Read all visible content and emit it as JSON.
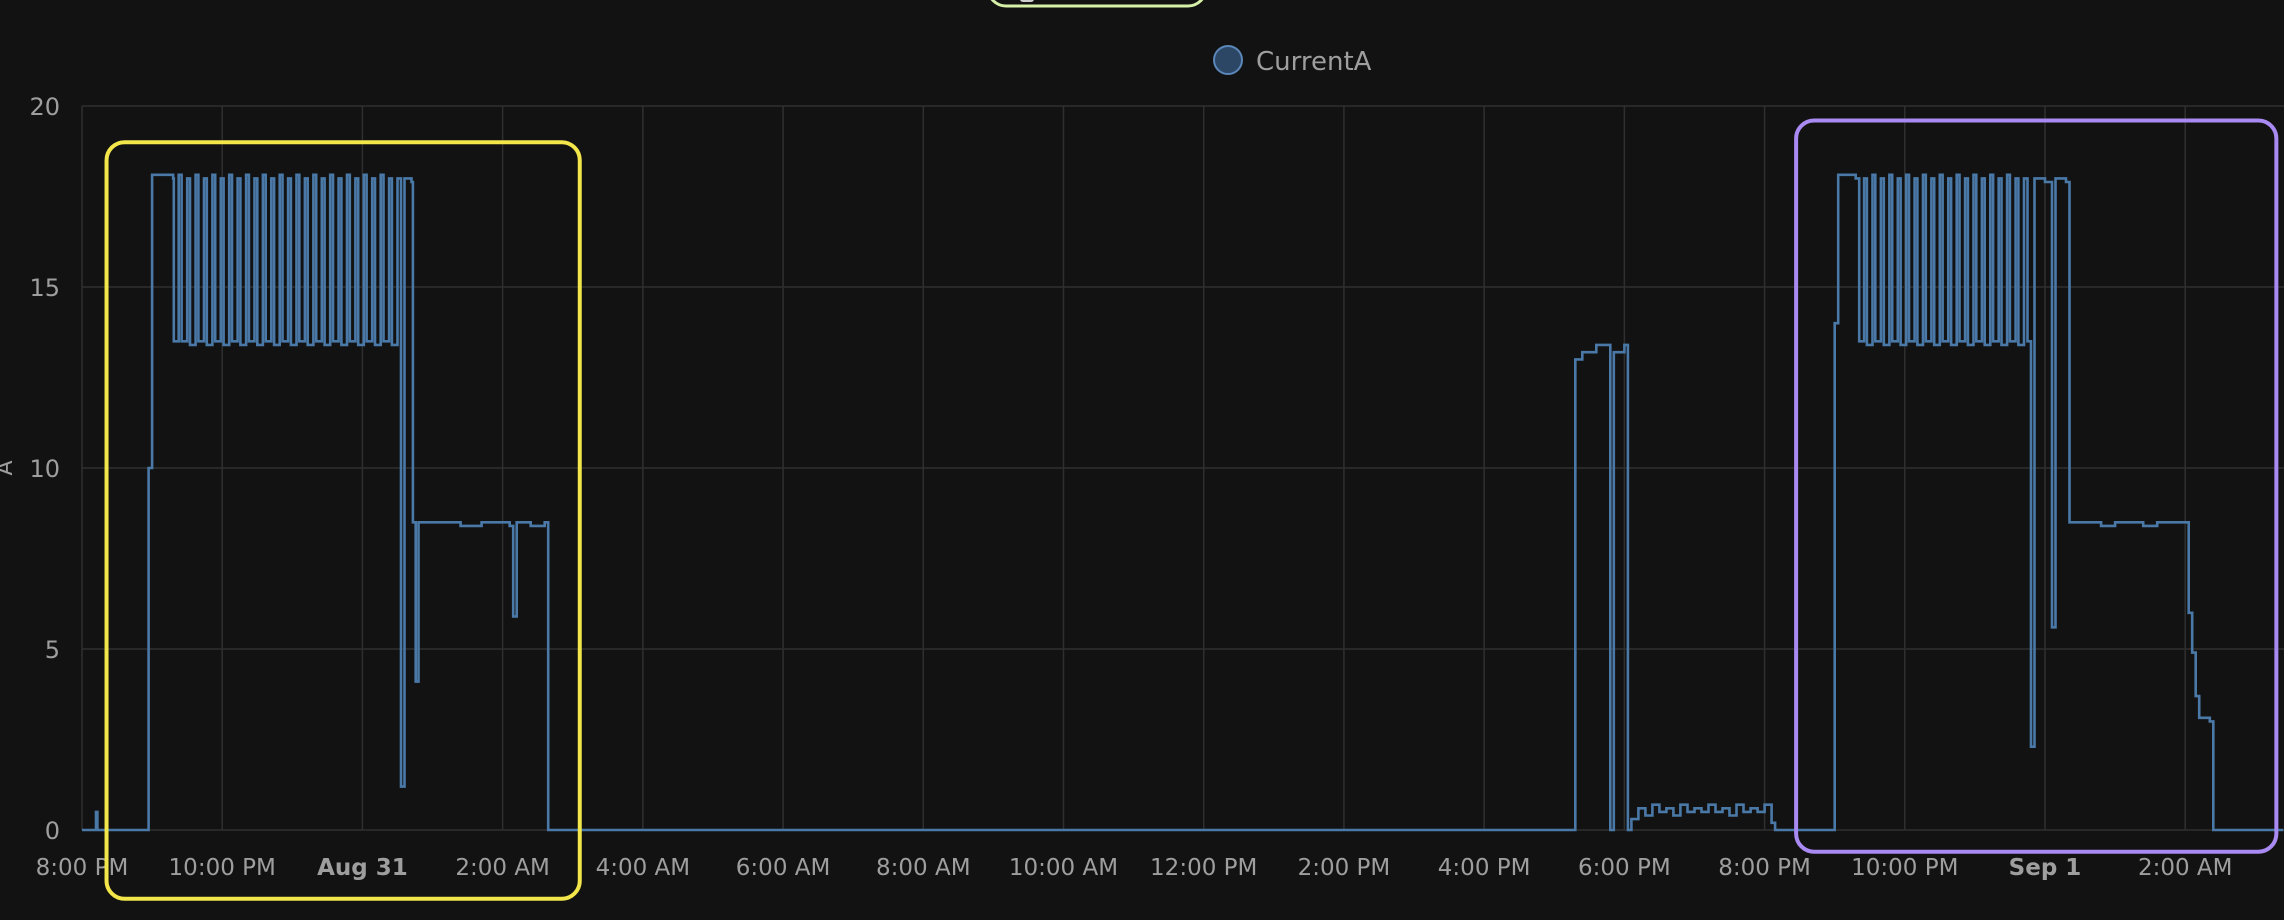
{
  "colors": {
    "background": "#121212",
    "grid": "#2f2f2f",
    "axis_text": "#9e9e9e",
    "series": "#4a79a8",
    "legend_swatch_fill": "#2c4766",
    "legend_swatch_border": "#5a86b8",
    "yellow_box": "#f2e64a",
    "purple_box": "#a98af2",
    "top_pill": "#d7f0a8"
  },
  "legend": {
    "label": "CurrentA"
  },
  "chart_data": {
    "type": "line",
    "title": "",
    "xlabel": "",
    "ylabel": "A",
    "ylim": [
      0,
      20
    ],
    "yticks": [
      0,
      5,
      10,
      15,
      20
    ],
    "x_unit": "hours since 8:00 PM (Aug 30)",
    "xlim": [
      0,
      31.4
    ],
    "xticks": [
      {
        "label": "8:00 PM",
        "bold": false
      },
      {
        "label": "10:00 PM",
        "bold": false
      },
      {
        "label": "Aug 31",
        "bold": true
      },
      {
        "label": "2:00 AM",
        "bold": false
      },
      {
        "label": "4:00 AM",
        "bold": false
      },
      {
        "label": "6:00 AM",
        "bold": false
      },
      {
        "label": "8:00 AM",
        "bold": false
      },
      {
        "label": "10:00 AM",
        "bold": false
      },
      {
        "label": "12:00 PM",
        "bold": false
      },
      {
        "label": "2:00 PM",
        "bold": false
      },
      {
        "label": "4:00 PM",
        "bold": false
      },
      {
        "label": "6:00 PM",
        "bold": false
      },
      {
        "label": "8:00 PM",
        "bold": false
      },
      {
        "label": "10:00 PM",
        "bold": false
      },
      {
        "label": "Sep 1",
        "bold": true
      },
      {
        "label": "2:00 AM",
        "bold": false
      }
    ],
    "series": [
      {
        "name": "CurrentA",
        "step": true,
        "points": [
          [
            0,
            0
          ],
          [
            0.2,
            0
          ],
          [
            0.2,
            0.5
          ],
          [
            0.22,
            0.5
          ],
          [
            0.22,
            0
          ],
          [
            0.95,
            0
          ],
          [
            0.95,
            10
          ],
          [
            1.0,
            18.1
          ],
          [
            1.3,
            18.0
          ],
          [
            1.3,
            18.0
          ],
          [
            1.31,
            13.5
          ],
          [
            1.38,
            18.1
          ],
          [
            1.42,
            13.5
          ],
          [
            1.5,
            18.0
          ],
          [
            1.54,
            13.4
          ],
          [
            1.62,
            18.1
          ],
          [
            1.66,
            13.5
          ],
          [
            1.74,
            18.0
          ],
          [
            1.78,
            13.4
          ],
          [
            1.86,
            18.1
          ],
          [
            1.9,
            13.5
          ],
          [
            1.98,
            18.0
          ],
          [
            2.02,
            13.4
          ],
          [
            2.1,
            18.1
          ],
          [
            2.14,
            13.5
          ],
          [
            2.22,
            18.0
          ],
          [
            2.26,
            13.4
          ],
          [
            2.34,
            18.1
          ],
          [
            2.38,
            13.5
          ],
          [
            2.46,
            18.0
          ],
          [
            2.5,
            13.4
          ],
          [
            2.58,
            18.1
          ],
          [
            2.62,
            13.5
          ],
          [
            2.7,
            18.0
          ],
          [
            2.74,
            13.4
          ],
          [
            2.82,
            18.1
          ],
          [
            2.86,
            13.5
          ],
          [
            2.94,
            18.0
          ],
          [
            2.98,
            13.4
          ],
          [
            3.06,
            18.1
          ],
          [
            3.1,
            13.5
          ],
          [
            3.18,
            18.0
          ],
          [
            3.22,
            13.4
          ],
          [
            3.3,
            18.1
          ],
          [
            3.34,
            13.5
          ],
          [
            3.42,
            18.0
          ],
          [
            3.46,
            13.4
          ],
          [
            3.54,
            18.1
          ],
          [
            3.58,
            13.5
          ],
          [
            3.66,
            18.0
          ],
          [
            3.7,
            13.4
          ],
          [
            3.78,
            18.1
          ],
          [
            3.82,
            13.5
          ],
          [
            3.9,
            18.0
          ],
          [
            3.94,
            13.4
          ],
          [
            4.02,
            18.1
          ],
          [
            4.06,
            13.5
          ],
          [
            4.14,
            18.0
          ],
          [
            4.18,
            13.4
          ],
          [
            4.26,
            18.1
          ],
          [
            4.3,
            13.5
          ],
          [
            4.38,
            18.0
          ],
          [
            4.42,
            13.4
          ],
          [
            4.5,
            18.0
          ],
          [
            4.55,
            13.4
          ],
          [
            4.55,
            1.2
          ],
          [
            4.6,
            18.0
          ],
          [
            4.7,
            17.9
          ],
          [
            4.72,
            8.5
          ],
          [
            4.76,
            4.1
          ],
          [
            4.8,
            8.5
          ],
          [
            5.3,
            8.5
          ],
          [
            5.4,
            8.4
          ],
          [
            5.7,
            8.5
          ],
          [
            6.1,
            8.4
          ],
          [
            6.15,
            5.9
          ],
          [
            6.2,
            8.5
          ],
          [
            6.4,
            8.4
          ],
          [
            6.6,
            8.5
          ],
          [
            6.65,
            0
          ],
          [
            21.3,
            0
          ],
          [
            21.3,
            13.0
          ],
          [
            21.4,
            13.2
          ],
          [
            21.6,
            13.4
          ],
          [
            21.8,
            13.4
          ],
          [
            21.8,
            0
          ],
          [
            21.85,
            13.2
          ],
          [
            22.0,
            13.4
          ],
          [
            22.05,
            0
          ],
          [
            22.1,
            0.3
          ],
          [
            22.2,
            0.6
          ],
          [
            22.3,
            0.4
          ],
          [
            22.4,
            0.7
          ],
          [
            22.5,
            0.5
          ],
          [
            22.6,
            0.6
          ],
          [
            22.7,
            0.4
          ],
          [
            22.8,
            0.7
          ],
          [
            22.9,
            0.5
          ],
          [
            23.0,
            0.6
          ],
          [
            23.1,
            0.5
          ],
          [
            23.2,
            0.7
          ],
          [
            23.3,
            0.5
          ],
          [
            23.4,
            0.6
          ],
          [
            23.5,
            0.4
          ],
          [
            23.6,
            0.7
          ],
          [
            23.7,
            0.5
          ],
          [
            23.8,
            0.6
          ],
          [
            23.9,
            0.5
          ],
          [
            24.0,
            0.7
          ],
          [
            24.1,
            0.2
          ],
          [
            24.15,
            0
          ],
          [
            24.95,
            0
          ],
          [
            25.0,
            14.0
          ],
          [
            25.05,
            18.1
          ],
          [
            25.3,
            18.0
          ],
          [
            25.35,
            13.5
          ],
          [
            25.42,
            18.0
          ],
          [
            25.46,
            13.4
          ],
          [
            25.54,
            18.1
          ],
          [
            25.58,
            13.5
          ],
          [
            25.66,
            18.0
          ],
          [
            25.7,
            13.4
          ],
          [
            25.78,
            18.1
          ],
          [
            25.82,
            13.5
          ],
          [
            25.9,
            18.0
          ],
          [
            25.94,
            13.4
          ],
          [
            26.02,
            18.1
          ],
          [
            26.06,
            13.5
          ],
          [
            26.14,
            18.0
          ],
          [
            26.18,
            13.4
          ],
          [
            26.26,
            18.1
          ],
          [
            26.3,
            13.5
          ],
          [
            26.38,
            18.0
          ],
          [
            26.42,
            13.4
          ],
          [
            26.5,
            18.1
          ],
          [
            26.54,
            13.5
          ],
          [
            26.62,
            18.0
          ],
          [
            26.66,
            13.4
          ],
          [
            26.74,
            18.1
          ],
          [
            26.78,
            13.5
          ],
          [
            26.86,
            18.0
          ],
          [
            26.9,
            13.4
          ],
          [
            26.98,
            18.1
          ],
          [
            27.02,
            13.5
          ],
          [
            27.1,
            18.0
          ],
          [
            27.14,
            13.4
          ],
          [
            27.22,
            18.1
          ],
          [
            27.26,
            13.5
          ],
          [
            27.34,
            18.0
          ],
          [
            27.38,
            13.4
          ],
          [
            27.46,
            18.1
          ],
          [
            27.5,
            13.5
          ],
          [
            27.58,
            18.0
          ],
          [
            27.62,
            13.4
          ],
          [
            27.7,
            18.0
          ],
          [
            27.75,
            13.5
          ],
          [
            27.8,
            2.3
          ],
          [
            27.85,
            18.0
          ],
          [
            28.0,
            17.9
          ],
          [
            28.1,
            5.6
          ],
          [
            28.15,
            18.0
          ],
          [
            28.3,
            17.9
          ],
          [
            28.35,
            8.5
          ],
          [
            28.6,
            8.5
          ],
          [
            28.8,
            8.4
          ],
          [
            29.0,
            8.5
          ],
          [
            29.4,
            8.4
          ],
          [
            29.6,
            8.5
          ],
          [
            30.0,
            8.5
          ],
          [
            30.05,
            6.0
          ],
          [
            30.1,
            4.9
          ],
          [
            30.15,
            3.7
          ],
          [
            30.2,
            3.1
          ],
          [
            30.35,
            3.0
          ],
          [
            30.4,
            0
          ],
          [
            31.4,
            0
          ]
        ]
      }
    ],
    "highlights": [
      {
        "name": "yellow-box",
        "x_start": 0.35,
        "x_end": 7.1,
        "y_bottom": -1.9,
        "y_top": 19.0,
        "color": "yellow_box"
      },
      {
        "name": "purple-box",
        "x_start": 24.45,
        "x_end": 31.3,
        "y_bottom": -0.6,
        "y_top": 19.6,
        "color": "purple_box"
      }
    ]
  }
}
